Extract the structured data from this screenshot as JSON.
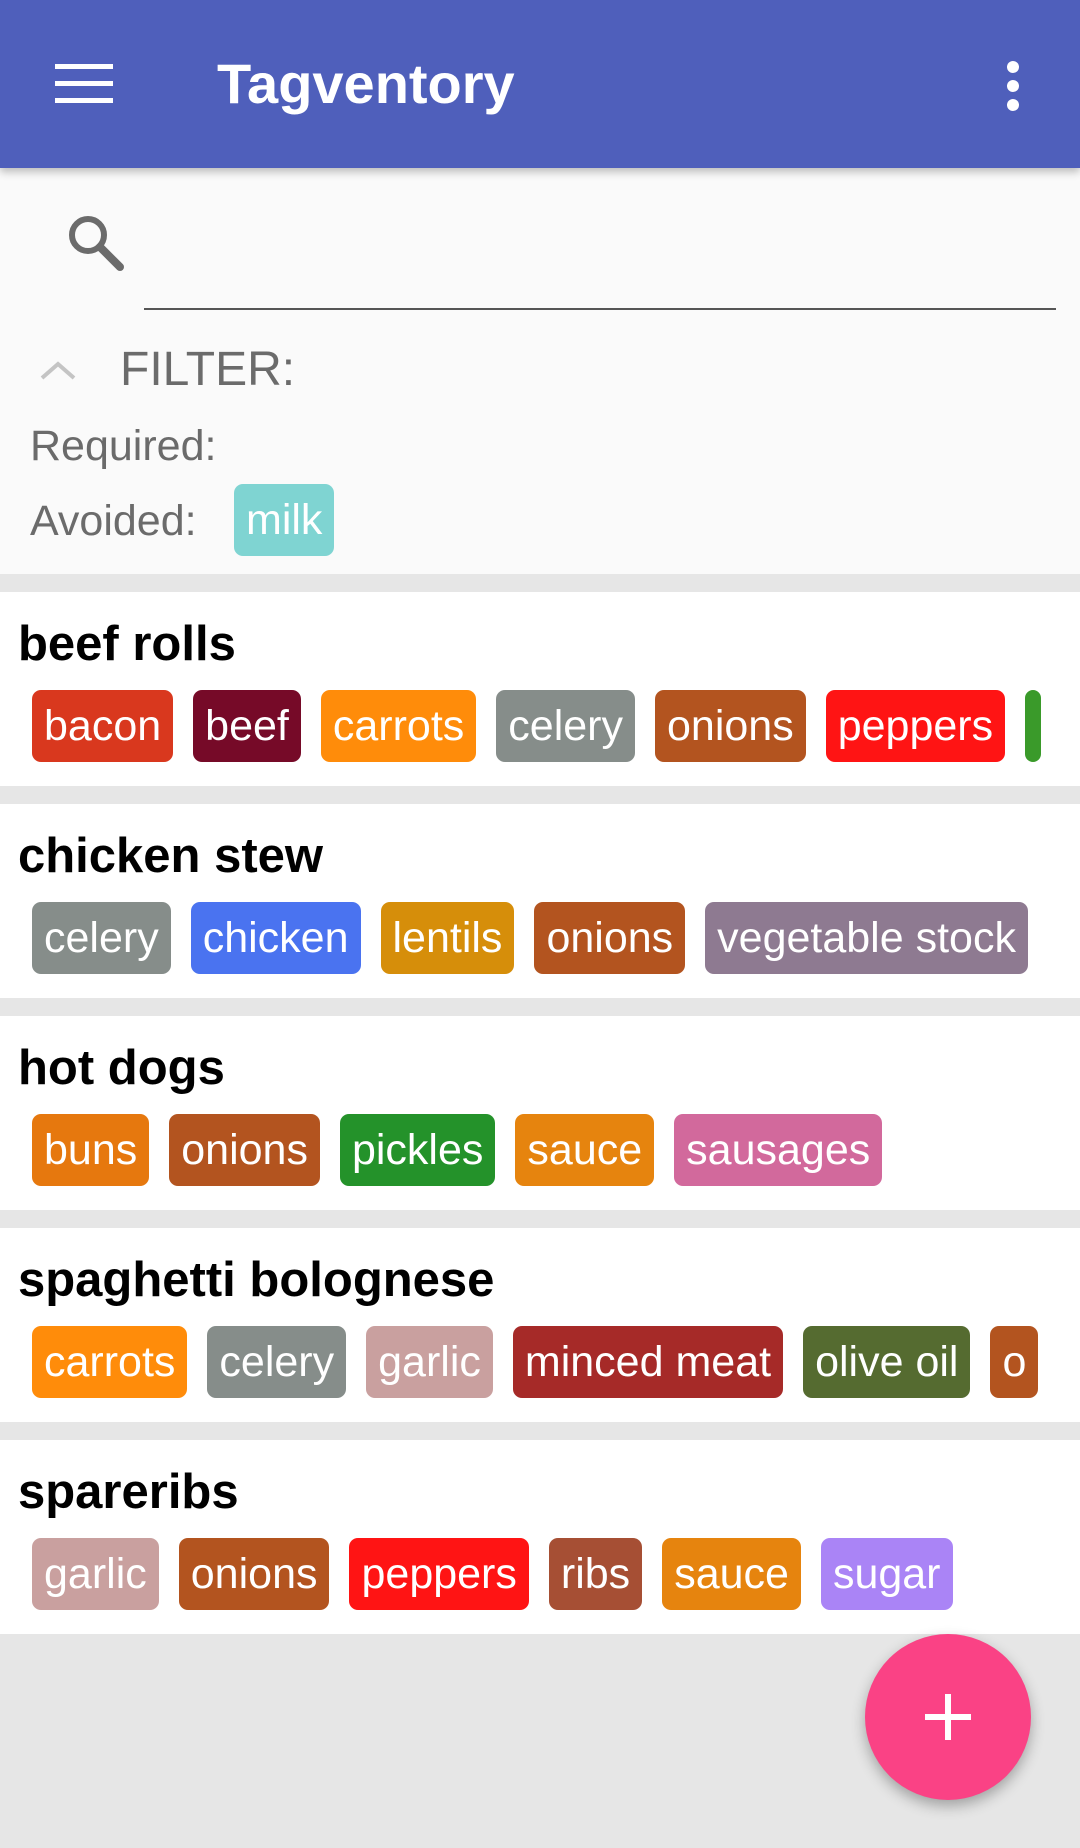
{
  "app": {
    "title": "Tagventory",
    "primary_color": "#4f5fbb",
    "menu_icon": "hamburger-menu-icon",
    "overflow_icon": "more-vertical-icon"
  },
  "search": {
    "icon": "search-icon",
    "value": "",
    "placeholder": ""
  },
  "filter": {
    "toggle_icon": "chevron-up-icon",
    "label": "FILTER:",
    "required_label": "Required:",
    "required_tags": [],
    "avoided_label": "Avoided:",
    "avoided_tags": [
      {
        "label": "milk",
        "color": "#7fd4d2"
      }
    ]
  },
  "recipes": [
    {
      "name": "beef rolls",
      "tags": [
        {
          "label": "bacon",
          "color": "#d9381e"
        },
        {
          "label": "beef",
          "color": "#760a28"
        },
        {
          "label": "carrots",
          "color": "#ff8c0a"
        },
        {
          "label": "celery",
          "color": "#868d8a"
        },
        {
          "label": "onions",
          "color": "#b3541f"
        },
        {
          "label": "peppers",
          "color": "#ff1414"
        },
        {
          "label": "",
          "color": "#3a9a2a"
        }
      ]
    },
    {
      "name": "chicken stew",
      "tags": [
        {
          "label": "celery",
          "color": "#868d8a"
        },
        {
          "label": "chicken",
          "color": "#4a73f0"
        },
        {
          "label": "lentils",
          "color": "#d68e0a"
        },
        {
          "label": "onions",
          "color": "#b3541f"
        },
        {
          "label": "vegetable stock",
          "color": "#8e7a91"
        }
      ]
    },
    {
      "name": "hot dogs",
      "tags": [
        {
          "label": "buns",
          "color": "#e6780e"
        },
        {
          "label": "onions",
          "color": "#b3541f"
        },
        {
          "label": "pickles",
          "color": "#24922a"
        },
        {
          "label": "sauce",
          "color": "#e6840e"
        },
        {
          "label": "sausages",
          "color": "#d2699c"
        }
      ]
    },
    {
      "name": "spaghetti bolognese",
      "tags": [
        {
          "label": "carrots",
          "color": "#ff8c0a"
        },
        {
          "label": "celery",
          "color": "#868d8a"
        },
        {
          "label": "garlic",
          "color": "#c9a09f"
        },
        {
          "label": "minced meat",
          "color": "#a62a28"
        },
        {
          "label": "olive oil",
          "color": "#556b30"
        },
        {
          "label": "o",
          "color": "#b3541f"
        }
      ]
    },
    {
      "name": "spareribs",
      "tags": [
        {
          "label": "garlic",
          "color": "#c9a09f"
        },
        {
          "label": "onions",
          "color": "#b3541f"
        },
        {
          "label": "peppers",
          "color": "#ff1414"
        },
        {
          "label": "ribs",
          "color": "#a64f34"
        },
        {
          "label": "sauce",
          "color": "#e6840e"
        },
        {
          "label": "sugar",
          "color": "#aa84f6"
        }
      ]
    }
  ],
  "fab": {
    "icon": "plus-icon",
    "color": "#fa4285"
  }
}
